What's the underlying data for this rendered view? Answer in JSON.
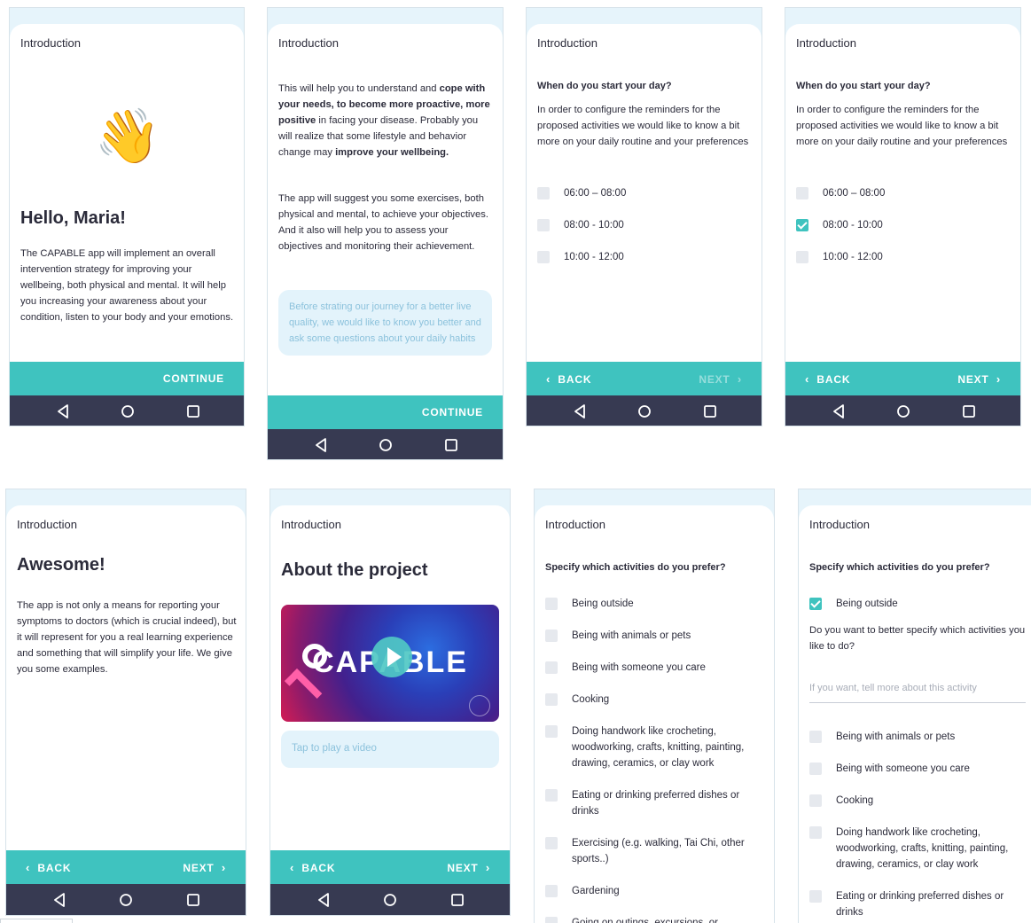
{
  "common": {
    "header": "Introduction",
    "continue": "CONTINUE",
    "back": "BACK",
    "next": "NEXT",
    "chev_left": "‹",
    "chev_right": "›"
  },
  "s1": {
    "emoji": "👋",
    "title": "Hello, Maria!",
    "paragraph": "The CAPABLE app will implement an overall intervention strategy for improving your wellbeing, both physical and mental. It will help you increasing your awareness about your condition, listen to your body and your emotions."
  },
  "s2": {
    "p1_a": "This will help you to understand and ",
    "p1_b": "cope with your needs, to become more proactive, more positive",
    "p1_c": " in facing your disease. Probably you will realize that some lifestyle and behavior change may ",
    "p1_d": "improve your wellbeing.",
    "p2": "The app will suggest you some exercises, both physical and mental, to achieve your objectives. And it also will help you to assess your objectives and monitoring their achievement.",
    "bubble": "Before strating our journey for a better live quality, we would like to know you better and ask some questions about your daily habits"
  },
  "s3": {
    "question": "When do you start your day?",
    "desc": "In order to configure the reminders for the proposed activities we would like to know a bit more on your daily routine and your preferences",
    "options": [
      {
        "label": "06:00 – 08:00",
        "checked": false
      },
      {
        "label": "08:00 - 10:00",
        "checked": false
      },
      {
        "label": "10:00 - 12:00",
        "checked": false
      }
    ]
  },
  "s4": {
    "question": "When do you start your day?",
    "desc": "In order to configure the reminders for the proposed activities we would like to know a bit more on your daily routine and your preferences",
    "options": [
      {
        "label": "06:00 – 08:00",
        "checked": false
      },
      {
        "label": "08:00 - 10:00",
        "checked": true
      },
      {
        "label": "10:00 - 12:00",
        "checked": false
      }
    ]
  },
  "s5": {
    "title": "Awesome!",
    "paragraph": "The app is not only a means for reporting your symptoms to doctors (which is crucial indeed), but it will represent for you a real learning experience and something that will simplify your life. We give you some examples."
  },
  "s6": {
    "title": "About the project",
    "video_logo": "CAPABLE",
    "tap": "Tap to play a video"
  },
  "s7": {
    "question": "Specify which activities do you prefer?",
    "options": [
      {
        "label": "Being outside",
        "checked": false
      },
      {
        "label": "Being with animals or pets",
        "checked": false
      },
      {
        "label": "Being with someone you care",
        "checked": false
      },
      {
        "label": "Cooking",
        "checked": false
      },
      {
        "label": "Doing handwork like crocheting, woodworking, crafts, knitting, painting, drawing, ceramics, or clay work",
        "checked": false
      },
      {
        "label": "Eating or drinking preferred dishes or drinks",
        "checked": false
      },
      {
        "label": "Exercising (e.g. walking, Tai Chi, other sports..)",
        "checked": false
      },
      {
        "label": "Gardening",
        "checked": false
      },
      {
        "label": "Going on outings, excursions, or",
        "checked": false
      }
    ]
  },
  "s8": {
    "question": "Specify which activities do you prefer?",
    "first": {
      "label": "Being outside",
      "checked": true
    },
    "followup": "Do you want to better specify which activities you like to do?",
    "placeholder": "If you want, tell more about this activity",
    "options": [
      {
        "label": "Being with animals or pets",
        "checked": false
      },
      {
        "label": "Being with someone you care",
        "checked": false
      },
      {
        "label": "Cooking",
        "checked": false
      },
      {
        "label": "Doing handwork like crocheting, woodworking, crafts, knitting, painting, drawing, ceramics, or clay work",
        "checked": false
      },
      {
        "label": "Eating or drinking preferred dishes or drinks",
        "checked": false
      }
    ]
  }
}
